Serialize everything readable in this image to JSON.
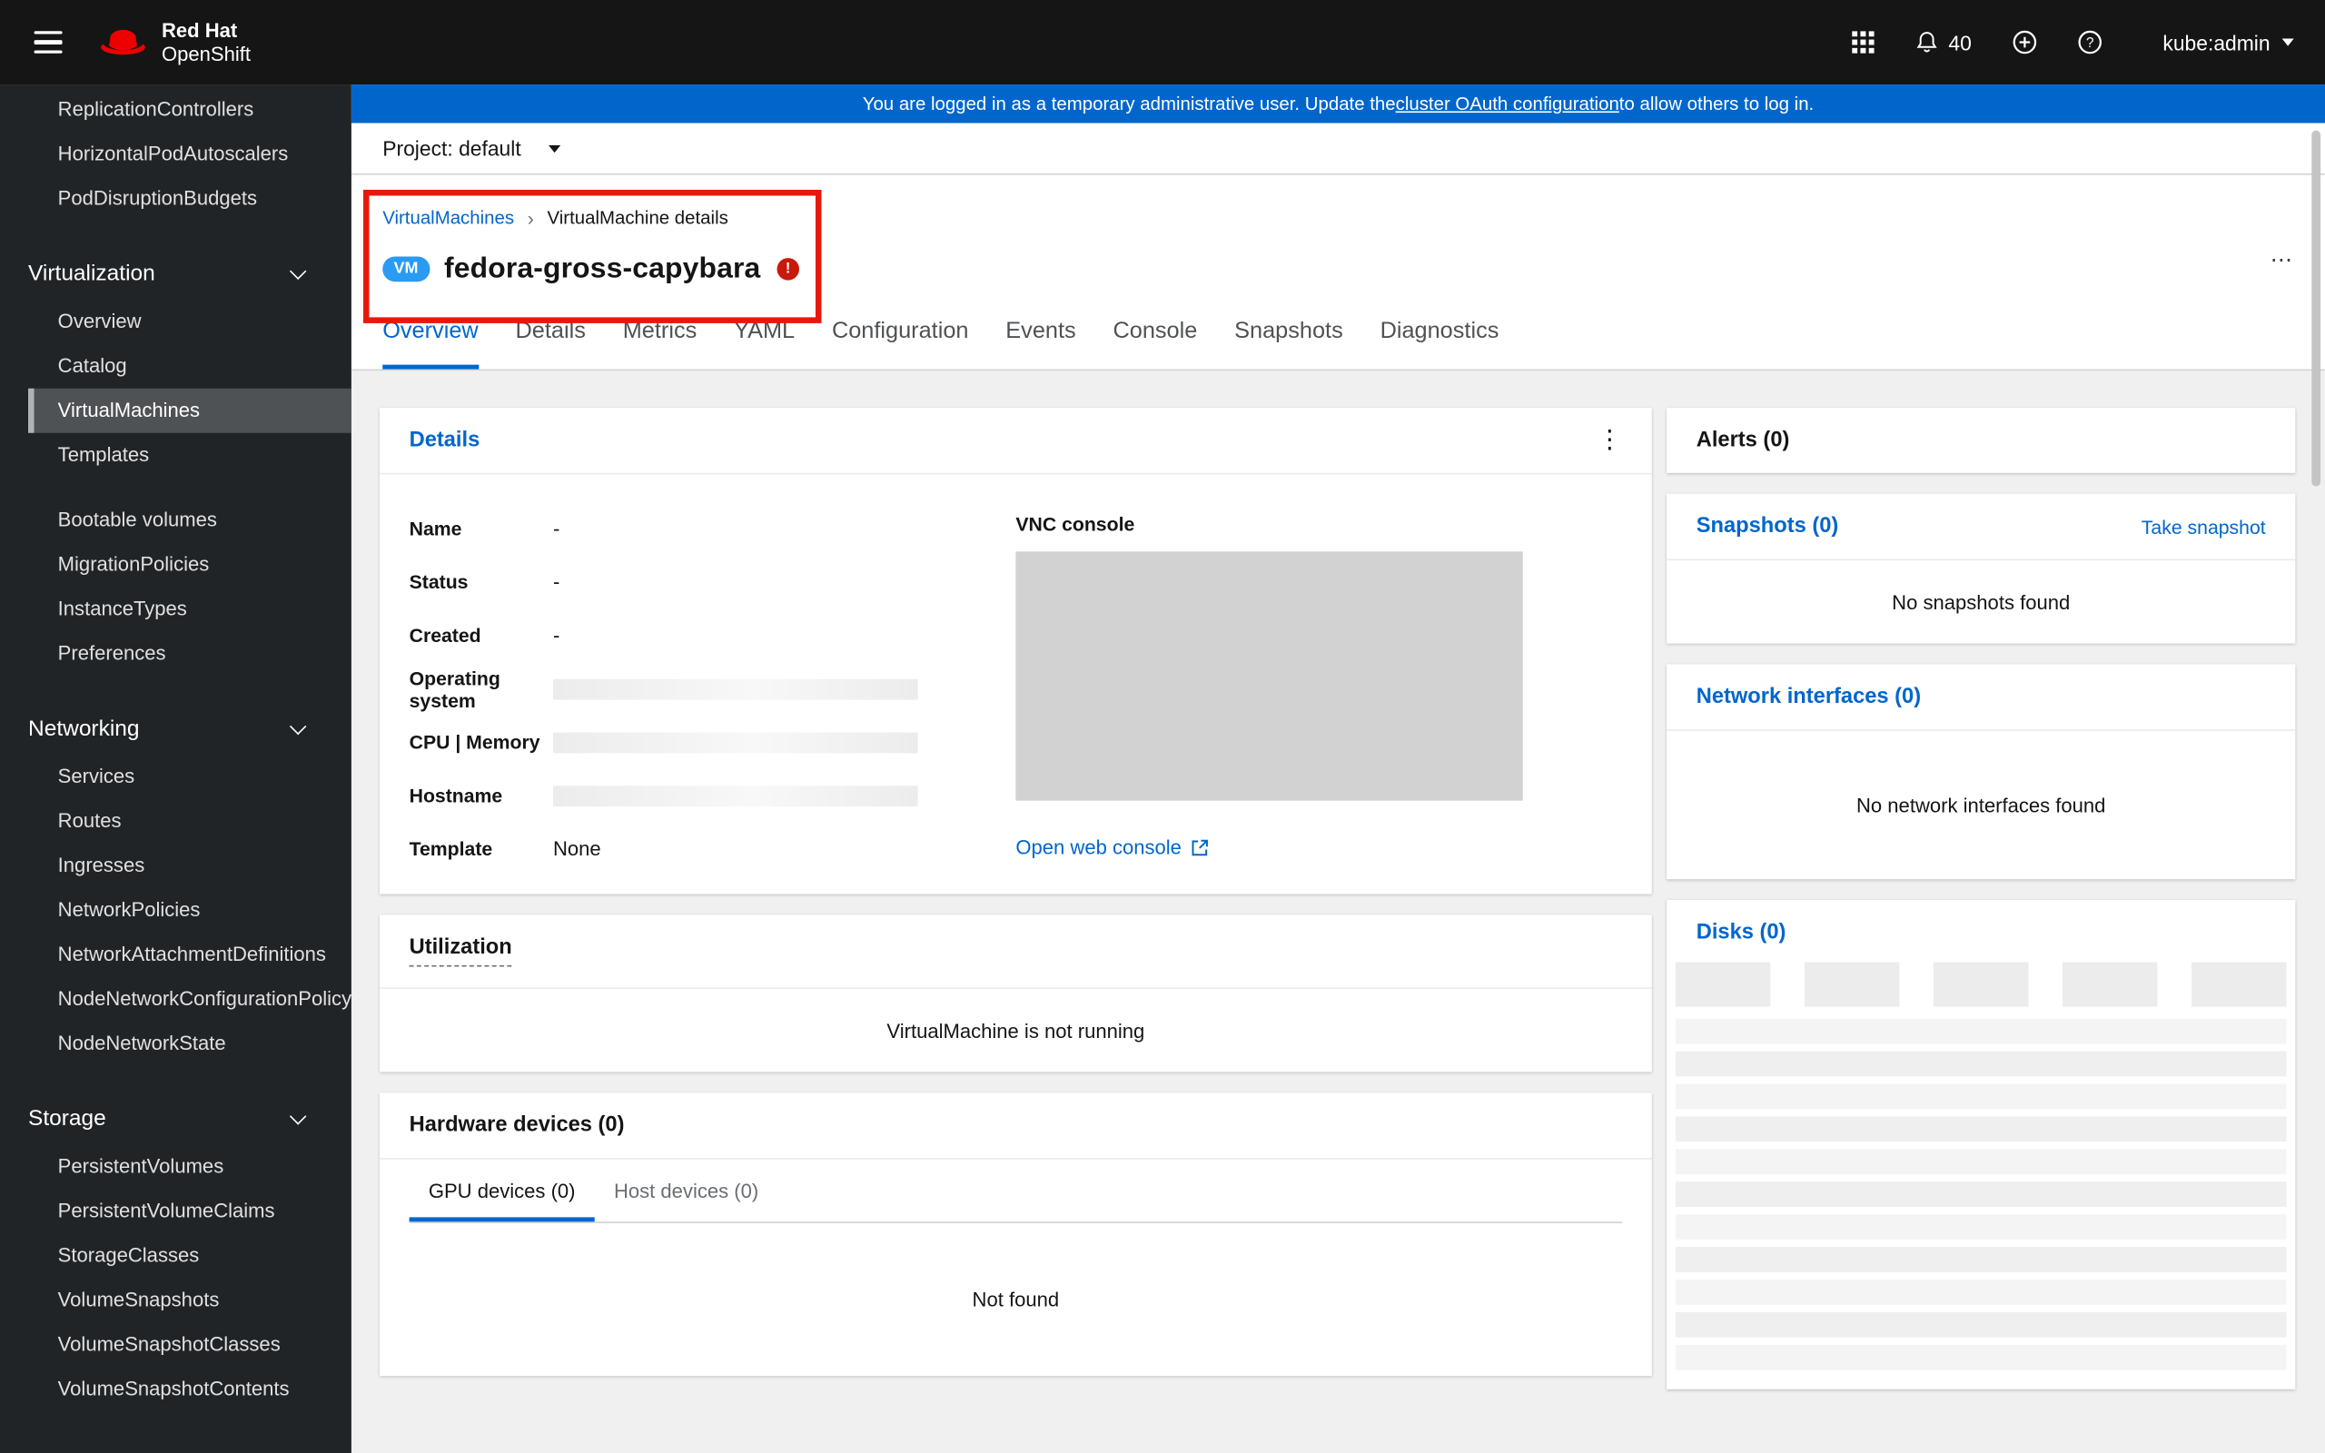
{
  "masthead": {
    "brand_top": "Red Hat",
    "brand_bottom": "OpenShift",
    "notification_count": "40",
    "username": "kube:admin"
  },
  "banner": {
    "prefix": "You are logged in as a temporary administrative user. Update the ",
    "link_text": "cluster OAuth configuration",
    "suffix": " to allow others to log in."
  },
  "project_bar": {
    "label": "Project: default"
  },
  "sidebar": {
    "top_items": [
      "ReplicationControllers",
      "HorizontalPodAutoscalers",
      "PodDisruptionBudgets"
    ],
    "sections": [
      {
        "label": "Virtualization",
        "items": [
          "Overview",
          "Catalog",
          "VirtualMachines",
          "Templates",
          "Bootable volumes",
          "MigrationPolicies",
          "InstanceTypes",
          "Preferences"
        ],
        "selected": "VirtualMachines"
      },
      {
        "label": "Networking",
        "items": [
          "Services",
          "Routes",
          "Ingresses",
          "NetworkPolicies",
          "NetworkAttachmentDefinitions",
          "NodeNetworkConfigurationPolicy",
          "NodeNetworkState"
        ]
      },
      {
        "label": "Storage",
        "items": [
          "PersistentVolumes",
          "PersistentVolumeClaims",
          "StorageClasses",
          "VolumeSnapshots",
          "VolumeSnapshotClasses",
          "VolumeSnapshotContents"
        ]
      }
    ]
  },
  "breadcrumb": {
    "first": "VirtualMachines",
    "second": "VirtualMachine details"
  },
  "title": {
    "badge": "VM",
    "name": "fedora-gross-capybara"
  },
  "tabs": [
    {
      "label": "Overview",
      "active": true
    },
    {
      "label": "Details"
    },
    {
      "label": "Metrics"
    },
    {
      "label": "YAML"
    },
    {
      "label": "Configuration"
    },
    {
      "label": "Events"
    },
    {
      "label": "Console"
    },
    {
      "label": "Snapshots"
    },
    {
      "label": "Diagnostics"
    }
  ],
  "details_card": {
    "title": "Details",
    "fields": [
      {
        "label": "Name",
        "value": "-"
      },
      {
        "label": "Status",
        "value": "-"
      },
      {
        "label": "Created",
        "value": "-"
      },
      {
        "label": "Operating system",
        "value": "",
        "skeleton": true
      },
      {
        "label": "CPU | Memory",
        "value": "",
        "skeleton": true
      },
      {
        "label": "Hostname",
        "value": "",
        "skeleton": true
      },
      {
        "label": "Template",
        "value": "None"
      }
    ],
    "vnc_label": "VNC console",
    "web_console_link": "Open web console"
  },
  "utilization_card": {
    "title": "Utilization",
    "empty_text": "VirtualMachine is not running"
  },
  "hardware_card": {
    "title": "Hardware devices (0)",
    "tabs": [
      {
        "label": "GPU devices (0)",
        "active": true
      },
      {
        "label": "Host devices (0)"
      }
    ],
    "empty_text": "Not found"
  },
  "alerts_card": {
    "title": "Alerts (0)"
  },
  "snapshots_card": {
    "title": "Snapshots (0)",
    "action": "Take snapshot",
    "empty_text": "No snapshots found"
  },
  "network_card": {
    "title": "Network interfaces (0)",
    "empty_text": "No network interfaces found"
  },
  "disks_card": {
    "title": "Disks (0)"
  },
  "icons": {
    "breadcrumb_separator": "›",
    "error_mark": "!",
    "kebab_vertical": "⋮",
    "kebab_horizontal": "⋯"
  },
  "colors": {
    "link_blue": "#0066cc",
    "banner_blue": "#0066cc",
    "badge_blue": "#2b9af3",
    "error_red": "#c9190b",
    "masthead_black": "#151515",
    "sidebar_dark": "#212427",
    "annotation_red": "#e7180b"
  }
}
